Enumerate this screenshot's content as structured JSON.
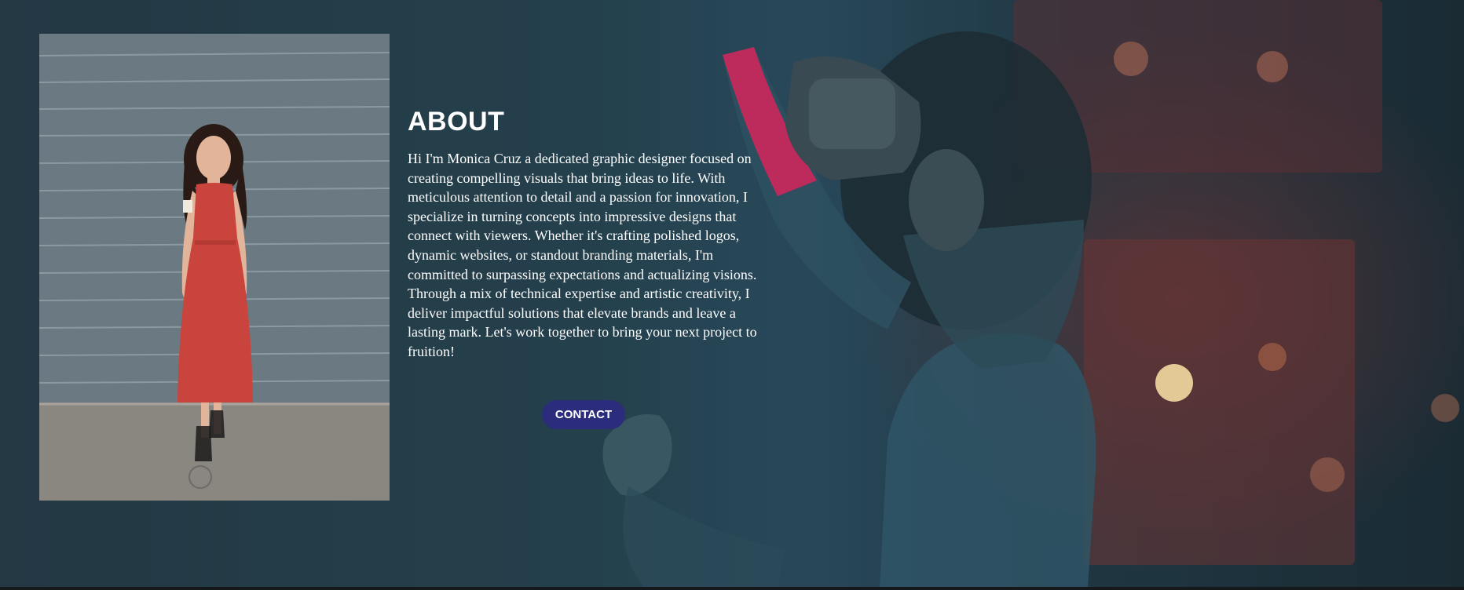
{
  "about": {
    "title": "ABOUT",
    "body": "Hi I'm Monica Cruz a dedicated graphic designer focused on creating compelling visuals that bring ideas to life. With meticulous attention to detail and a passion for innovation, I specialize in turning concepts into impressive designs that connect with viewers. Whether it's crafting polished logos, dynamic websites, or standout branding materials, I'm committed to surpassing expectations and actualizing visions. Through a mix of technical expertise and artistic creativity, I deliver impactful solutions that elevate brands and leave a lasting mark. Let's work together to bring your next project to fruition!",
    "contact_label": "CONTACT"
  },
  "colors": {
    "background": "#233843",
    "button": "#2b2d7c",
    "text": "#ffffff",
    "dress": "#c8443d"
  }
}
